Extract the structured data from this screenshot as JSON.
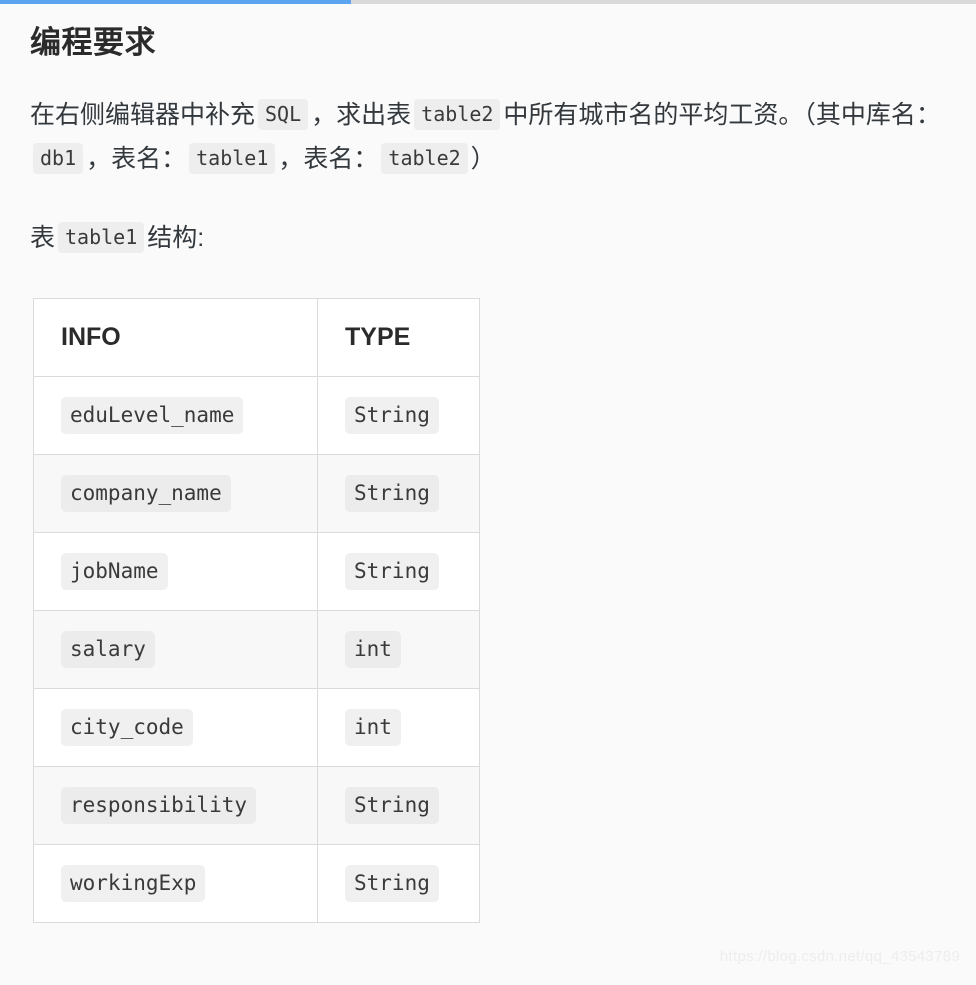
{
  "progress": {
    "percent": 36,
    "fill_color": "#5ba4f0",
    "track_color": "#d9d9d9"
  },
  "heading": {
    "title": "编程要求"
  },
  "paragraphs": {
    "first": {
      "part1": "在右侧编辑器中补充",
      "code1": "SQL",
      "part2": "，求出表",
      "code2": "table2",
      "part3": "中所有城市名的平均工资。（其中库名：",
      "code3": "db1",
      "part4": "，表名：",
      "code4": "table1",
      "part5": "，表名：",
      "code5": "table2",
      "part6": "）"
    },
    "second": {
      "part1": "表",
      "code1": "table1",
      "part2": "结构:"
    }
  },
  "table": {
    "headers": [
      "INFO",
      "TYPE"
    ],
    "rows": [
      {
        "info": "eduLevel_name",
        "type": "String"
      },
      {
        "info": "company_name",
        "type": "String"
      },
      {
        "info": "jobName",
        "type": "String"
      },
      {
        "info": "salary",
        "type": "int"
      },
      {
        "info": "city_code",
        "type": "int"
      },
      {
        "info": "responsibility",
        "type": "String"
      },
      {
        "info": "workingExp",
        "type": "String"
      }
    ]
  },
  "watermark": {
    "text": "https://blog.csdn.net/qq_43543789"
  }
}
